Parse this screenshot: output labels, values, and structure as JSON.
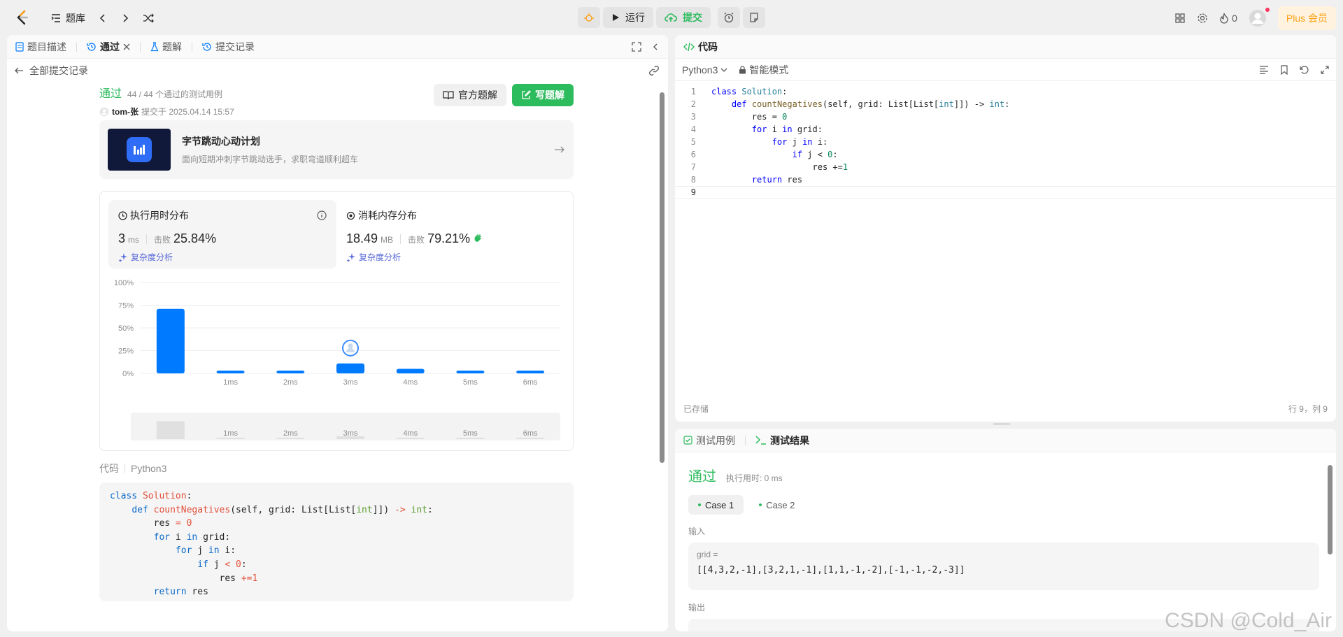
{
  "header": {
    "problem_bank": "题库",
    "run": "运行",
    "submit": "提交",
    "streak": "0",
    "plus": "Plus 会员"
  },
  "left": {
    "tabs": [
      "题目描述",
      "通过",
      "题解",
      "提交记录"
    ],
    "back_label": "全部提交记录",
    "status": "通过",
    "cases": "44 / 44 个通过的测试用例",
    "user": "tom-张",
    "submitted_at": "提交于 2025.04.14 15:57",
    "official_solution": "官方题解",
    "write_solution": "写题解",
    "banner_title": "字节跳动心动计划",
    "banner_sub": "面向短期冲刺字节跳动选手，求职弯道顺利超车",
    "runtime": {
      "title": "执行用时分布",
      "value": "3",
      "unit": "ms",
      "beats_label": "击败",
      "beats": "25.84%",
      "analysis": "复杂度分析"
    },
    "memory": {
      "title": "消耗内存分布",
      "value": "18.49",
      "unit": "MB",
      "beats_label": "击败",
      "beats": "79.21%",
      "analysis": "复杂度分析"
    },
    "code_label": "代码",
    "code_lang": "Python3"
  },
  "chart_data": {
    "type": "bar",
    "categories": [
      "",
      "1ms",
      "2ms",
      "3ms",
      "4ms",
      "5ms",
      "6ms"
    ],
    "values": [
      71,
      2,
      2,
      11,
      5,
      2,
      2
    ],
    "ylim": [
      0,
      100
    ],
    "yticks": [
      "0%",
      "25%",
      "50%",
      "75%",
      "100%"
    ],
    "highlight_index": 3,
    "grid": true,
    "bar_color": "#007aff"
  },
  "editor": {
    "tab": "代码",
    "lang": "Python3",
    "mode": "智能模式",
    "saved": "已存储",
    "cursor": "行 9，列 9",
    "lines": [
      "class Solution:",
      "    def countNegatives(self, grid: List[List[int]]) -> int:",
      "        res = 0",
      "        for i in grid:",
      "            for j in i:",
      "                if j < 0:",
      "                    res +=1",
      "        return res",
      ""
    ]
  },
  "result": {
    "tabs": [
      "测试用例",
      "测试结果"
    ],
    "status": "通过",
    "time": "执行用时: 0 ms",
    "cases": [
      "Case 1",
      "Case 2"
    ],
    "input_label": "输入",
    "var_name": "grid =",
    "input_value": "[[4,3,2,-1],[3,2,1,-1],[1,1,-1,-2],[-1,-1,-2,-3]]",
    "output_label": "输出"
  },
  "watermark": "CSDN @Cold_Air"
}
